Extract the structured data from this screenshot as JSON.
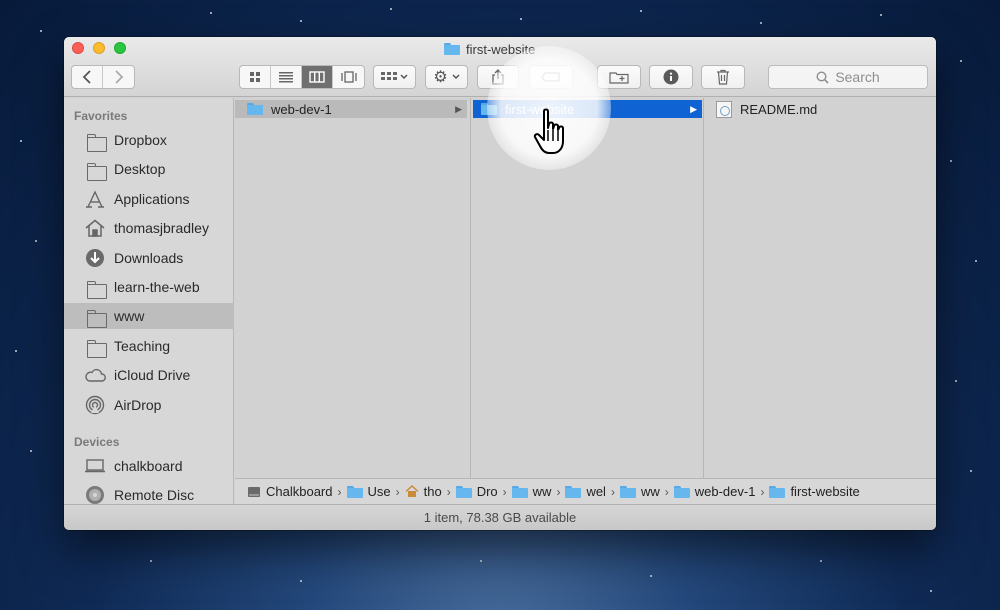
{
  "window": {
    "title": "first-website"
  },
  "toolbar": {
    "search_placeholder": "Search",
    "back_icon": "chevron-left-icon",
    "forward_icon": "chevron-right-icon"
  },
  "sidebar": {
    "favorites_header": "Favorites",
    "devices_header": "Devices",
    "favorites": [
      {
        "label": "Dropbox",
        "icon": "folder-icon"
      },
      {
        "label": "Desktop",
        "icon": "folder-icon"
      },
      {
        "label": "Applications",
        "icon": "applications-icon"
      },
      {
        "label": "thomasjbradley",
        "icon": "home-icon"
      },
      {
        "label": "Downloads",
        "icon": "download-icon"
      },
      {
        "label": "learn-the-web",
        "icon": "folder-icon"
      },
      {
        "label": "www",
        "icon": "folder-icon",
        "selected": true
      },
      {
        "label": "Teaching",
        "icon": "folder-icon"
      },
      {
        "label": "iCloud Drive",
        "icon": "cloud-icon"
      },
      {
        "label": "AirDrop",
        "icon": "airdrop-icon"
      }
    ],
    "devices": [
      {
        "label": "chalkboard",
        "icon": "laptop-icon"
      },
      {
        "label": "Remote Disc",
        "icon": "disc-icon"
      }
    ]
  },
  "columns": {
    "col1": {
      "label": "web-dev-1"
    },
    "col2": {
      "label": "first-website"
    },
    "col3": {
      "label": "README.md"
    }
  },
  "pathbar": {
    "items": [
      "Chalkboard",
      "Use",
      "tho",
      "Dro",
      "ww",
      "wel",
      "ww",
      "web-dev-1",
      "first-website"
    ]
  },
  "status": {
    "text": "1 item, 78.38 GB available"
  },
  "colors": {
    "selection_blue": "#0f63d2",
    "close": "#fc5f57",
    "minimize": "#fdbb2e",
    "zoom": "#28c73f"
  }
}
